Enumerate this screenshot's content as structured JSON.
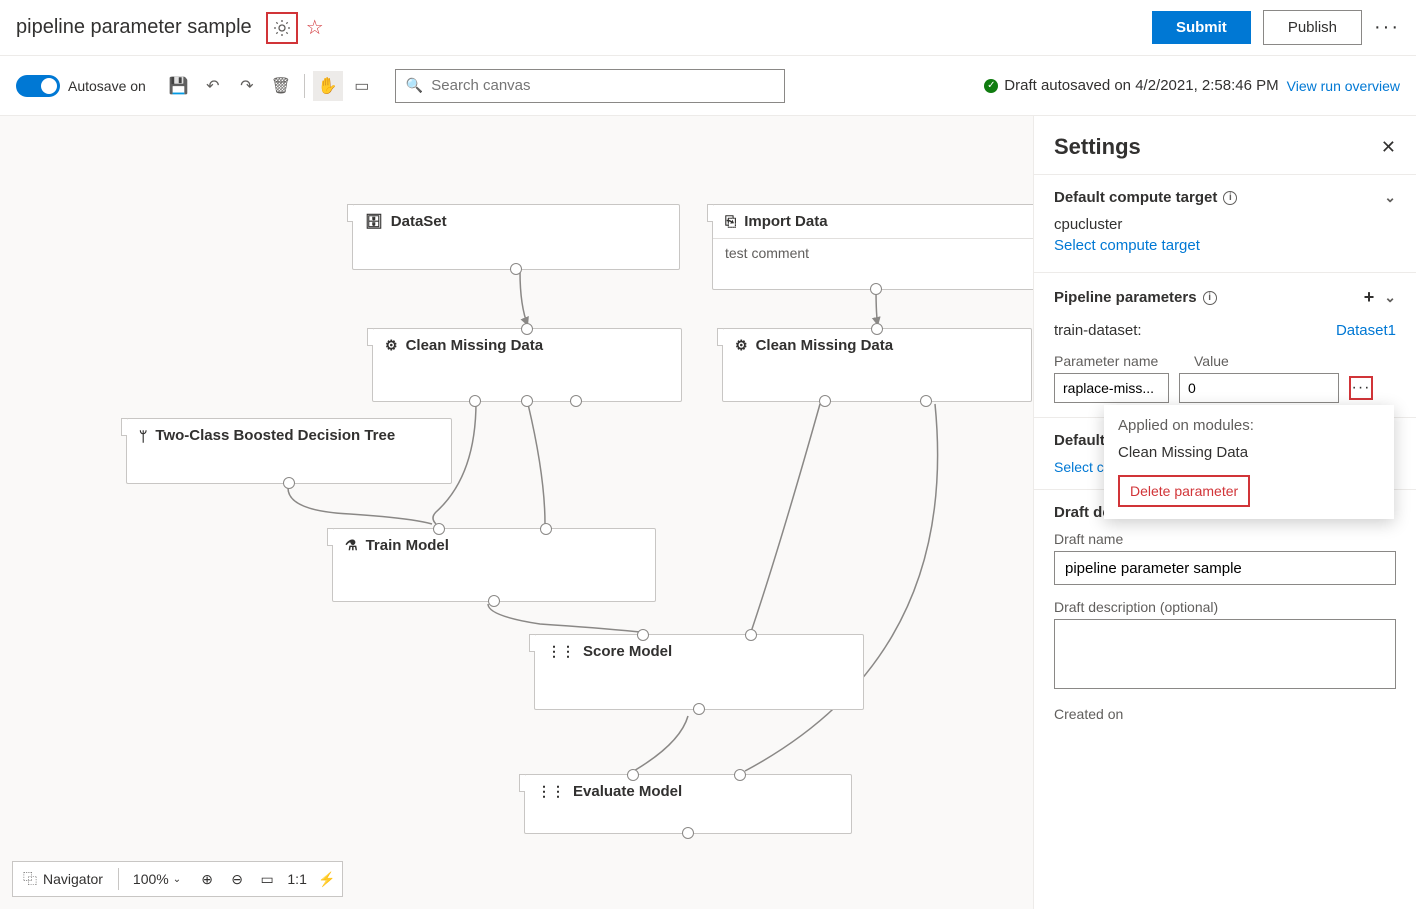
{
  "header": {
    "title": "pipeline parameter sample",
    "submit": "Submit",
    "publish": "Publish"
  },
  "toolbar": {
    "autosave_label": "Autosave on",
    "search_placeholder": "Search canvas",
    "status": "Draft autosaved on 4/2/2021, 2:58:46 PM",
    "view_run": "View run overview"
  },
  "nodes": {
    "dataset": "DataSet",
    "import_data": "Import Data",
    "import_data_sub": "test comment",
    "clean1": "Clean Missing Data",
    "clean2": "Clean Missing Data",
    "tree": "Two-Class Boosted Decision Tree",
    "train": "Train Model",
    "score": "Score Model",
    "evaluate": "Evaluate Model"
  },
  "panel": {
    "title": "Settings",
    "compute": {
      "title": "Default compute target",
      "value": "cpucluster",
      "link": "Select compute target"
    },
    "params": {
      "title": "Pipeline parameters",
      "row_label": "train-dataset:",
      "row_value": "Dataset1",
      "col_name": "Parameter name",
      "col_value": "Value",
      "name_input": "raplace-miss...",
      "value_input": "0",
      "popover_title": "Applied on modules:",
      "popover_module": "Clean Missing Data",
      "delete": "Delete parameter"
    },
    "default_hidden": {
      "label_prefix": "Default",
      "link_prefix": "Select c"
    },
    "draft": {
      "title": "Draft details",
      "name_label": "Draft name",
      "name_value": "pipeline parameter sample",
      "desc_label": "Draft description (optional)",
      "created_label": "Created on"
    }
  },
  "bottombar": {
    "navigator": "Navigator",
    "zoom": "100%"
  }
}
